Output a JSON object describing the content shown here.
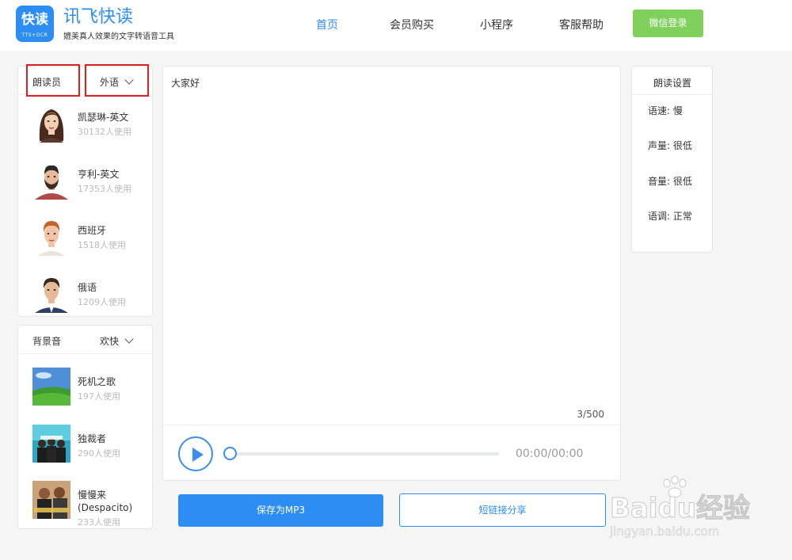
{
  "header": {
    "logo_main": "快读",
    "logo_small": "TTS+OCR",
    "brand_title": "讯飞快读",
    "brand_subtitle": "媲美真人效果的文字转语音工具",
    "nav": [
      {
        "label": "首页"
      },
      {
        "label": "会员购买"
      },
      {
        "label": "小程序"
      },
      {
        "label": "客服帮助"
      }
    ],
    "login_label": "微信登录",
    "accent_color": "#2c8df4",
    "login_color": "#7fd15c"
  },
  "readers": {
    "header_label": "朗读员",
    "dropdown_value": "外语",
    "items": [
      {
        "name": "凯瑟琳-英文",
        "count": "30132人使用",
        "icon": "woman-avatar"
      },
      {
        "name": "亨利-英文",
        "count": "17353人使用",
        "icon": "bearded-man-avatar"
      },
      {
        "name": "西班牙",
        "count": "1518人使用",
        "icon": "ginger-man-avatar"
      },
      {
        "name": "俄语",
        "count": "1209人使用",
        "icon": "suit-man-avatar"
      }
    ]
  },
  "bgm": {
    "header_label": "背景音",
    "dropdown_value": "欢快",
    "items": [
      {
        "name": "死机之歌",
        "count": "197人使用",
        "icon": "green-hills-thumbnail"
      },
      {
        "name": "独裁者",
        "count": "290人使用",
        "icon": "band-thumbnail"
      },
      {
        "name": "慢慢来 (Despacito)",
        "count": "233人使用",
        "icon": "despacito-thumbnail"
      }
    ]
  },
  "editor": {
    "text": "大家好",
    "char_count": "3/500"
  },
  "player": {
    "time": "00:00/00:00",
    "progress": 0
  },
  "actions": {
    "save_label": "保存为MP3",
    "share_label": "短链接分享"
  },
  "settings": {
    "title": "朗读设置",
    "items": [
      {
        "label": "语速: 慢"
      },
      {
        "label": "声量: 很低"
      },
      {
        "label": "音量: 很低"
      },
      {
        "label": "语调: 正常"
      }
    ]
  },
  "watermark": {
    "main": "Baidu经验",
    "sub": "jingyan.baidu.com"
  }
}
